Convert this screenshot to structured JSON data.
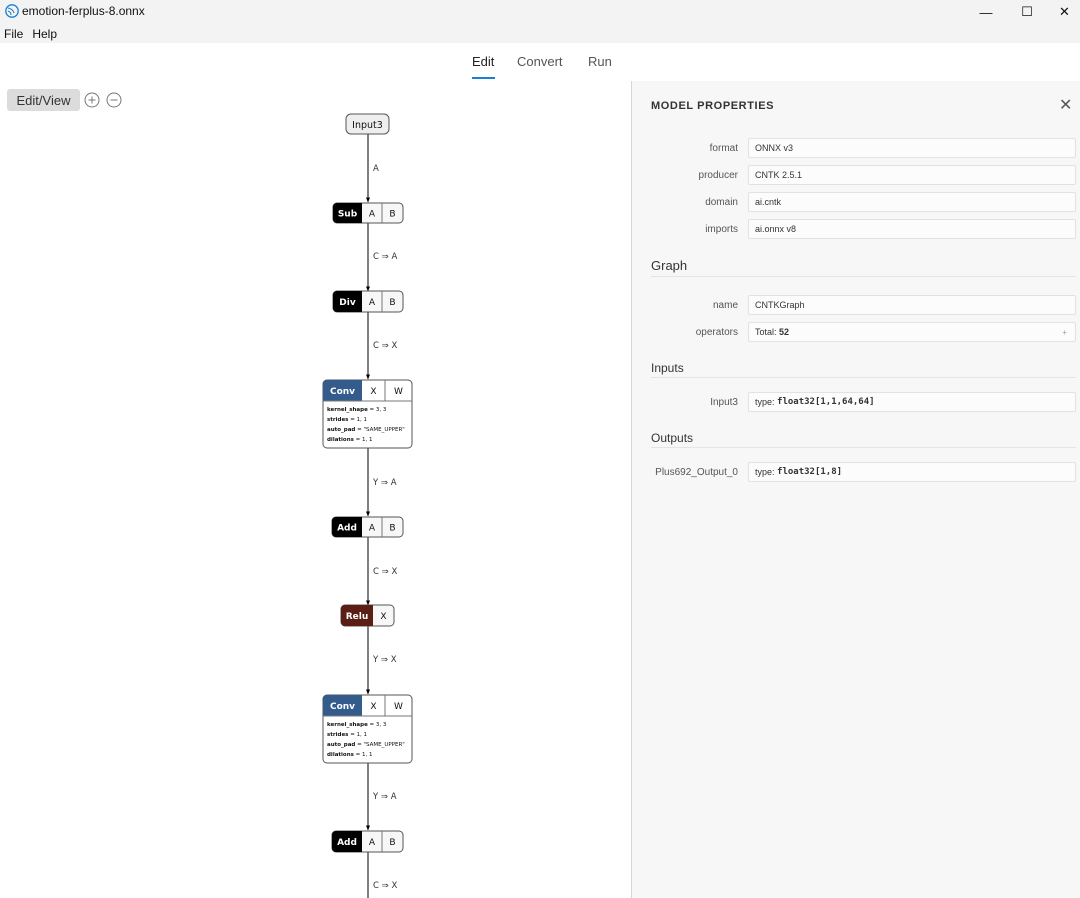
{
  "window": {
    "title": "emotion-ferplus-8.onnx",
    "minimize_glyph": "—",
    "maximize_glyph": "☐",
    "close_glyph": "✕"
  },
  "menu": [
    "File",
    "Help"
  ],
  "tabs": [
    {
      "label": "Edit",
      "active": true
    },
    {
      "label": "Convert",
      "active": false
    },
    {
      "label": "Run",
      "active": false
    }
  ],
  "toolbar": {
    "edit_view_label": "Edit/View",
    "zoom_in_icon": "zoom-in-icon",
    "zoom_out_icon": "zoom-out-icon"
  },
  "graph": {
    "input_node": "Input3",
    "edges": [
      "A",
      "C ⇒ A",
      "C ⇒ X",
      "Y ⇒ A",
      "C ⇒ X",
      "Y ⇒ X",
      "Y ⇒ A",
      "C ⇒ X"
    ],
    "nodes": [
      {
        "op": "Sub",
        "inputs": [
          "A",
          "B"
        ],
        "color": "#000000"
      },
      {
        "op": "Div",
        "inputs": [
          "A",
          "B"
        ],
        "color": "#000000"
      },
      {
        "op": "Conv",
        "inputs": [
          "X",
          "W"
        ],
        "color": "#335b8c",
        "attrs": [
          {
            "name": "kernel_shape",
            "value": "3, 3"
          },
          {
            "name": "strides",
            "value": "1, 1"
          },
          {
            "name": "auto_pad",
            "value": "\"SAME_UPPER\""
          },
          {
            "name": "dilations",
            "value": "1, 1"
          }
        ]
      },
      {
        "op": "Add",
        "inputs": [
          "A",
          "B"
        ],
        "color": "#000000"
      },
      {
        "op": "Relu",
        "inputs": [
          "X"
        ],
        "color": "#5a1e14"
      },
      {
        "op": "Conv",
        "inputs": [
          "X",
          "W"
        ],
        "color": "#335b8c",
        "attrs": [
          {
            "name": "kernel_shape",
            "value": "3, 3"
          },
          {
            "name": "strides",
            "value": "1, 1"
          },
          {
            "name": "auto_pad",
            "value": "\"SAME_UPPER\""
          },
          {
            "name": "dilations",
            "value": "1, 1"
          }
        ]
      },
      {
        "op": "Add",
        "inputs": [
          "A",
          "B"
        ],
        "color": "#000000"
      }
    ]
  },
  "panel": {
    "title": "MODEL PROPERTIES",
    "close_glyph": "✕",
    "model": [
      {
        "label": "format",
        "value": "ONNX v3"
      },
      {
        "label": "producer",
        "value": "CNTK 2.5.1"
      },
      {
        "label": "domain",
        "value": "ai.cntk"
      },
      {
        "label": "imports",
        "value": "ai.onnx v8"
      }
    ],
    "graph_section": "Graph",
    "graph_props": {
      "name_label": "name",
      "name_value": "CNTKGraph",
      "operators_label": "operators",
      "operators_prefix": "Total:",
      "operators_count": "52",
      "expander_glyph": "+"
    },
    "inputs_section": "Inputs",
    "inputs": [
      {
        "label": "Input3",
        "type_prefix": "type:",
        "type": "float32[1,1,64,64]"
      }
    ],
    "outputs_section": "Outputs",
    "outputs": [
      {
        "label": "Plus692_Output_0",
        "type_prefix": "type:",
        "type": "float32[1,8]"
      }
    ]
  },
  "colors": {
    "accent": "#1a7fd4",
    "node_black": "#000000",
    "node_conv": "#335b8c",
    "node_relu": "#5a1e14"
  }
}
